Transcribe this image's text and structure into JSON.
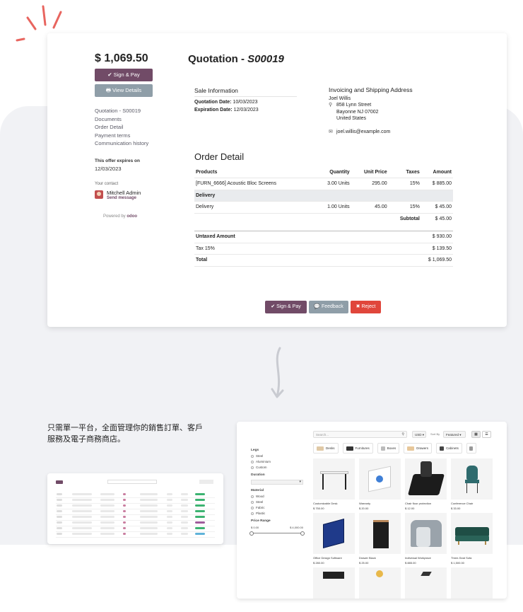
{
  "quote": {
    "amount": "$ 1,069.50",
    "sign_pay": "Sign & Pay",
    "view_details": "View Details",
    "nav": [
      "Quotation - S00019",
      "Documents",
      "Order Detail",
      "Payment terms",
      "Communication history"
    ],
    "offer_label": "This offer expires on",
    "offer_date": "12/03/2023",
    "contact_label": "Your contact",
    "contact_name": "Mitchell Admin",
    "send_message": "Send message",
    "powered_by": "Powered by",
    "powered_logo": "odoo",
    "title_prefix": "Quotation - ",
    "title_ref": "S00019",
    "sale_info": {
      "title": "Sale Information",
      "quotation_date_label": "Quotation Date:",
      "quotation_date": "10/03/2023",
      "expiration_date_label": "Expiration Date:",
      "expiration_date": "12/03/2023"
    },
    "address": {
      "title": "Invoicing and Shipping Address",
      "name": "Joel Willis",
      "line1": "858 Lynn Street",
      "line2": "Bayonne NJ 07002",
      "line3": "United States",
      "email": "joel.willis@example.com"
    },
    "order_title": "Order Detail",
    "headers": [
      "Products",
      "Quantity",
      "Unit Price",
      "Taxes",
      "Amount"
    ],
    "line1": {
      "product": "[FURN_6666] Acoustic Bloc Screens",
      "qty": "3.00 Units",
      "price": "295.00",
      "tax": "15%",
      "amount": "$ 885.00"
    },
    "section": "Delivery",
    "line2": {
      "product": "Delivery",
      "qty": "1.00 Units",
      "price": "45.00",
      "tax": "15%",
      "amount": "$ 45.00"
    },
    "subtotal_label": "Subtotal",
    "subtotal": "$ 45.00",
    "untaxed_label": "Untaxed Amount",
    "untaxed": "$ 930.00",
    "tax_label": "Tax 15%",
    "tax": "$ 139.50",
    "total_label": "Total",
    "total": "$ 1,069.50",
    "btn_sign": "Sign & Pay",
    "btn_feedback": "Feedback",
    "btn_reject": "Reject"
  },
  "promo": {
    "line1": "只需單一平台，全面管理你的銷售訂單、客戶",
    "line2": "服務及電子商務商店。"
  },
  "shop": {
    "search_placeholder": "Search...",
    "currency": "USD",
    "sort_by": "Sort By",
    "sort_value": "Featured",
    "categories": [
      "Desks",
      "Furnitures",
      "Boxes",
      "Drawers",
      "Cabinets"
    ],
    "filters": {
      "legs_title": "Legs",
      "legs": [
        "Steel",
        "Aluminium",
        "Custom"
      ],
      "duration_title": "Duration",
      "material_title": "Material",
      "materials": [
        "Wood",
        "Steel",
        "Fabric",
        "Plastic"
      ],
      "price_title": "Price Range",
      "price_min": "$ 0.00",
      "price_max": "$ 4,000.00"
    },
    "products": [
      {
        "name": "Customizable Desk",
        "price": "$ 750.00"
      },
      {
        "name": "Warranty",
        "price": "$ 20.00"
      },
      {
        "name": "Chair floor protection",
        "price": "$ 12.00"
      },
      {
        "name": "Conference Chair",
        "price": "$ 33.00"
      },
      {
        "name": "Office Design Software",
        "price": "$ 280.00"
      },
      {
        "name": "Drawer Black",
        "price": "$ 25.00"
      },
      {
        "name": "Individual Workplace",
        "price": "$ 885.00"
      },
      {
        "name": "Three-Seat Sofa",
        "price": "$ 1,500.00"
      }
    ]
  },
  "colors": {
    "primary": "#714b67",
    "secondary": "#8f9ea8",
    "danger": "#e0463b",
    "ray": "#e8655f"
  }
}
